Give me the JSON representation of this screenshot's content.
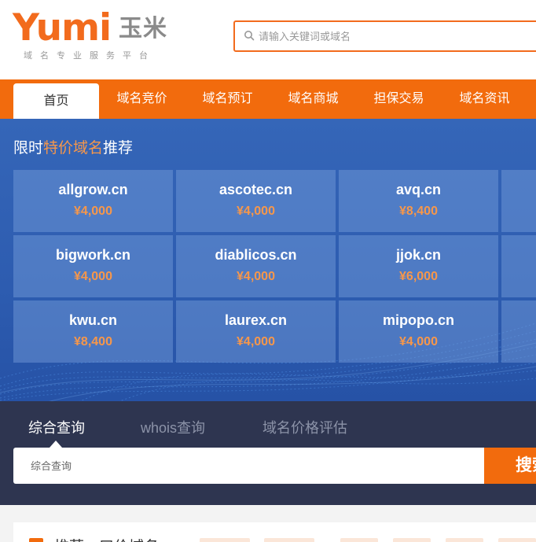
{
  "header": {
    "logo_text": "Yumi",
    "logo_cn": "玉米",
    "logo_tagline": "域名专业服务平台",
    "search_placeholder": "请输入关键词或域名"
  },
  "nav": {
    "items": [
      {
        "label": "首页",
        "active": true
      },
      {
        "label": "域名竞价",
        "active": false
      },
      {
        "label": "域名预订",
        "active": false
      },
      {
        "label": "域名商城",
        "active": false
      },
      {
        "label": "担保交易",
        "active": false
      },
      {
        "label": "域名资讯",
        "active": false
      }
    ]
  },
  "promo": {
    "title_prefix": "限时",
    "title_highlight": "特价域名",
    "title_suffix": "推荐",
    "domains": [
      {
        "name": "allgrow.cn",
        "price": "¥4,000"
      },
      {
        "name": "ascotec.cn",
        "price": "¥4,000"
      },
      {
        "name": "avq.cn",
        "price": "¥8,400"
      },
      {
        "name": "bigwork.cn",
        "price": "¥4,000"
      },
      {
        "name": "diablicos.cn",
        "price": "¥4,000"
      },
      {
        "name": "jjok.cn",
        "price": "¥6,000"
      },
      {
        "name": "kwu.cn",
        "price": "¥8,400"
      },
      {
        "name": "laurex.cn",
        "price": "¥4,000"
      },
      {
        "name": "mipopo.cn",
        "price": "¥4,000"
      }
    ]
  },
  "query": {
    "tabs": [
      {
        "label": "综合查询",
        "active": true
      },
      {
        "label": "whois查询",
        "active": false
      },
      {
        "label": "域名价格评估",
        "active": false
      }
    ],
    "input_placeholder": "综合查询",
    "search_button": "搜索"
  },
  "bottom": {
    "title": "推荐一口价域名"
  },
  "colors": {
    "brand_orange": "#f26b0d",
    "banner_blue": "#2d5cb0",
    "price_orange": "#f7974a",
    "query_bg": "#2e3550"
  }
}
